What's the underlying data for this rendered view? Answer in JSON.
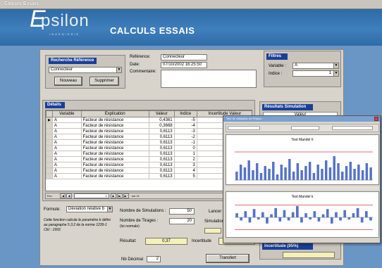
{
  "window": {
    "title": "Calculs Essais"
  },
  "banner": {
    "logo_letter": "E",
    "logo_text": "psilon",
    "logo_sub": "INGENIERIE",
    "app_title": "CALCULS ESSAIS"
  },
  "recherche": {
    "title": "Recherche Référence",
    "selected": "Connecteur",
    "nouveau": "Nouveau",
    "supprimer": "Supprimer"
  },
  "fields": {
    "reference_label": "Référence:",
    "reference_value": "Connecteur",
    "date_label": "Date:",
    "date_value": "07/10/2002 16:25:50",
    "commentaire_label": "Commentaire:"
  },
  "filtres": {
    "title": "Filtres",
    "variable_label": "Variable :",
    "variable_value": "A",
    "indice_label": "Indice :",
    "indice_value": "1"
  },
  "details": {
    "title": "Détails",
    "columns": [
      "Variable",
      "Explication",
      "Valeur",
      "Indice",
      "Incertitude Valeur"
    ],
    "rows": [
      [
        "A",
        "Facteur de résistance",
        "0,4361",
        "-5",
        "0,1475"
      ],
      [
        "A",
        "Facteur de résistance",
        "0,3668",
        "-4",
        "0,1473"
      ],
      [
        "A",
        "Facteur de résistance",
        "0,6113",
        "-3",
        "0,1483"
      ],
      [
        "A",
        "Facteur de résistance",
        "0,6113",
        "-2",
        "0,1483"
      ],
      [
        "A",
        "Facteur de résistance",
        "0,6113",
        "-1",
        "0,1483"
      ],
      [
        "A",
        "Facteur de résistance",
        "0,6113",
        "0",
        "0,1483"
      ],
      [
        "A",
        "Facteur de résistance",
        "0,6113",
        "1",
        "0,1483"
      ],
      [
        "A",
        "Facteur de résistance",
        "0,6113",
        "2",
        "0,1483"
      ],
      [
        "A",
        "Facteur de résistance",
        "0,6113",
        "3",
        "0,1483"
      ],
      [
        "A",
        "Facteur de résistance",
        "0,6113",
        "4",
        "0,1483"
      ],
      [
        "A",
        "Facteur de résistance",
        "0,6113",
        "5",
        "0,1483"
      ]
    ],
    "nav_label": "Enr :",
    "nav_record": "1",
    "nav_of": "sur 11"
  },
  "resultats_simulation": {
    "title": "Résultats Simulation",
    "col": "Valeur"
  },
  "formule": {
    "label": "Formule:",
    "value": "Déviation relative b",
    "description": "Cette fonction calcule le paramètre b défini au paragraphe 5.3.2 de la norme 1239-1 CEI : 1993"
  },
  "simulation": {
    "nb_label": "Nombre de Simulations :",
    "nb_value": "50",
    "lancer": "Lancer",
    "tirages_label": "Nombre de Tirages :",
    "tirages_sub": "(loi normale)",
    "tirages_value": "20",
    "simulation_label": "Simulation",
    "resultat_label": "Résultat:",
    "resultat_value": "0,37",
    "incertitude_label": "Incertitude",
    "incertitude95_label": "Incertitude (95%)",
    "nbdecimal_label": "Nb Décimal",
    "nbdecimal_value": "2",
    "transfert": "Transfert"
  },
  "chart_window": {
    "title": "Test de validation de l'Etalon",
    "chart1_title": "Test Mandel h",
    "chart2_title": "Test Mandel k"
  },
  "colors": {
    "accent": "#1b3f98",
    "banner": "#3f7fbc",
    "bars": "#5572c8",
    "limit_line": "#d04040"
  },
  "chart_data": [
    {
      "type": "bar",
      "title": "Test Mandel h",
      "values": [
        0.6,
        1.1,
        0.9,
        1.4,
        0.7,
        1.2,
        0.5,
        1.0,
        0.8,
        1.3,
        0.4,
        1.1,
        0.9,
        1.5,
        0.6,
        1.2,
        0.7,
        1.0,
        1.3,
        0.5,
        1.1,
        0.8,
        1.4,
        0.9,
        1.7,
        1.2,
        0.6,
        1.0,
        1.3,
        0.8,
        1.1,
        0.7,
        1.2,
        0.9
      ],
      "ylim": [
        0,
        2.5
      ],
      "limit_lines": [
        2.0
      ]
    },
    {
      "type": "bar",
      "title": "Test Mandel k",
      "values": [
        0.4,
        -0.3,
        0.6,
        -0.5,
        0.8,
        -0.2,
        0.5,
        -0.6,
        0.3,
        0.9,
        -0.4,
        0.7,
        -0.3,
        0.5,
        1.1,
        -0.5,
        0.4,
        -0.2,
        0.6,
        -0.4,
        0.3,
        0.8,
        -0.6,
        0.5,
        -0.3,
        0.7,
        -0.2,
        0.4,
        0.9,
        -0.5,
        0.6,
        -0.3
      ],
      "ylim": [
        -1.5,
        1.5
      ],
      "limit_lines": [
        1.2,
        -1.2
      ]
    }
  ]
}
